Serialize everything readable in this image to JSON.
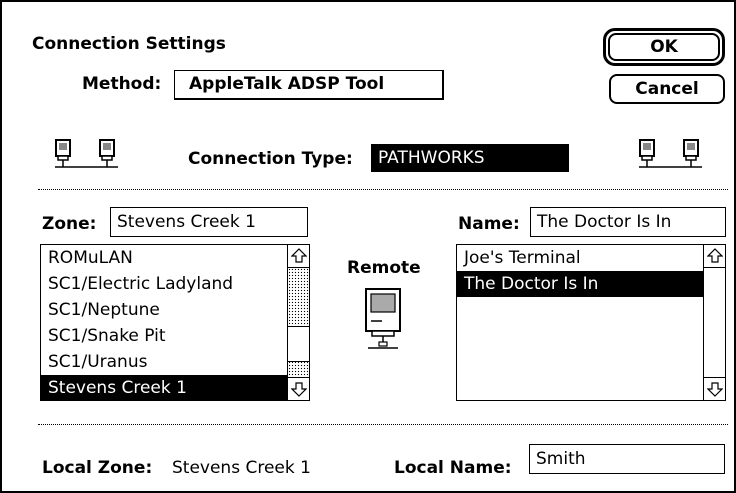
{
  "dialog": {
    "title": "Connection Settings",
    "method_label": "Method:",
    "method_value": "AppleTalk ADSP Tool",
    "ok_label": "OK",
    "cancel_label": "Cancel"
  },
  "connection": {
    "type_label": "Connection Type:",
    "type_value": "PATHWORKS"
  },
  "zone": {
    "label": "Zone:",
    "value": "Stevens Creek 1",
    "items": [
      "ROMuLAN",
      "SC1/Electric Ladyland",
      "SC1/Neptune",
      "SC1/Snake Pit",
      "SC1/Uranus",
      "Stevens Creek 1"
    ],
    "selected_index": 5
  },
  "remote": {
    "label": "Remote"
  },
  "name": {
    "label": "Name:",
    "value": "The Doctor Is In",
    "items": [
      "Joe's Terminal",
      "The Doctor Is In"
    ],
    "selected_index": 1
  },
  "local": {
    "zone_label": "Local Zone:",
    "zone_value": "Stevens Creek 1",
    "name_label": "Local Name:",
    "name_value": "Smith"
  },
  "icons": {
    "network_left": "network-computers-icon",
    "network_right": "network-computers-icon",
    "remote": "macintosh-computer-icon"
  }
}
